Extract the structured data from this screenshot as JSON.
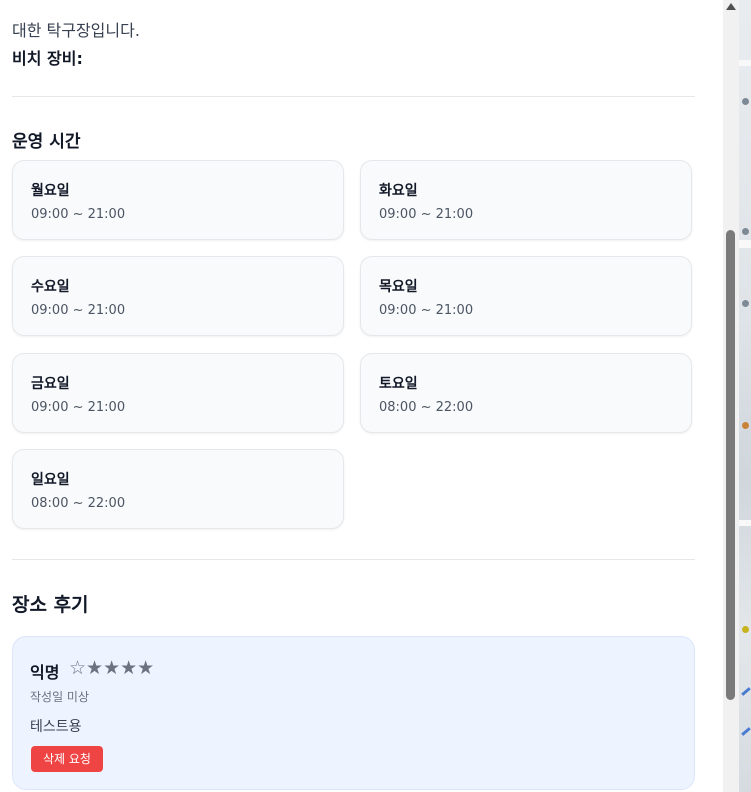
{
  "place": {
    "description_tail": "대한 탁구장입니다.",
    "equipment_label": "비치 장비:"
  },
  "hours": {
    "title": "운영 시간",
    "days": [
      {
        "day": "월요일",
        "time": "09:00 ~ 21:00"
      },
      {
        "day": "화요일",
        "time": "09:00 ~ 21:00"
      },
      {
        "day": "수요일",
        "time": "09:00 ~ 21:00"
      },
      {
        "day": "목요일",
        "time": "09:00 ~ 21:00"
      },
      {
        "day": "금요일",
        "time": "09:00 ~ 21:00"
      },
      {
        "day": "토요일",
        "time": "08:00 ~ 22:00"
      },
      {
        "day": "일요일",
        "time": "08:00 ~ 22:00"
      }
    ]
  },
  "reviews": {
    "title": "장소 후기",
    "items": [
      {
        "author": "익명",
        "stars": "☆★★★★",
        "date": "작성일 미상",
        "text": "테스트용",
        "delete_label": "삭제 요청"
      }
    ]
  },
  "colors": {
    "delete_button": "#ef4444",
    "review_card_bg": "#eef4ff",
    "day_card_bg": "#f9fafb"
  }
}
